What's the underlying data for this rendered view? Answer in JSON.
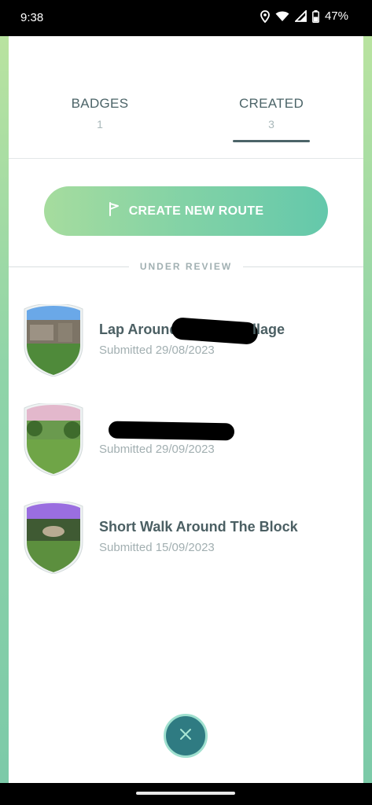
{
  "status_bar": {
    "time": "9:38",
    "battery": "47%",
    "icons": [
      "location-icon",
      "wifi-icon",
      "signal-icon",
      "battery-icon"
    ]
  },
  "tabs": [
    {
      "label": "BADGES",
      "count": "1",
      "active": false
    },
    {
      "label": "CREATED",
      "count": "3",
      "active": true
    }
  ],
  "create_button": {
    "label": "CREATE NEW ROUTE",
    "icon": "flag-icon"
  },
  "section": {
    "label": "UNDER REVIEW"
  },
  "routes": [
    {
      "name": "Lap Around",
      "name_suffix": "llage",
      "submitted": "Submitted 29/08/2023",
      "shield_top_color": "#6aa8e8",
      "redacted": true
    },
    {
      "name": "",
      "submitted": "Submitted 29/09/2023",
      "shield_top_color": "#e3b8cc",
      "redacted": true
    },
    {
      "name": "Short Walk Around The Block",
      "submitted": "Submitted 15/09/2023",
      "shield_top_color": "#9a6ee0",
      "redacted": false
    }
  ],
  "close_button": {
    "icon": "close-icon"
  },
  "colors": {
    "accent": "#4c6468",
    "button_gradient_start": "#a6dc9e",
    "button_gradient_end": "#64c8ab",
    "close_bg": "#2f7b82"
  }
}
